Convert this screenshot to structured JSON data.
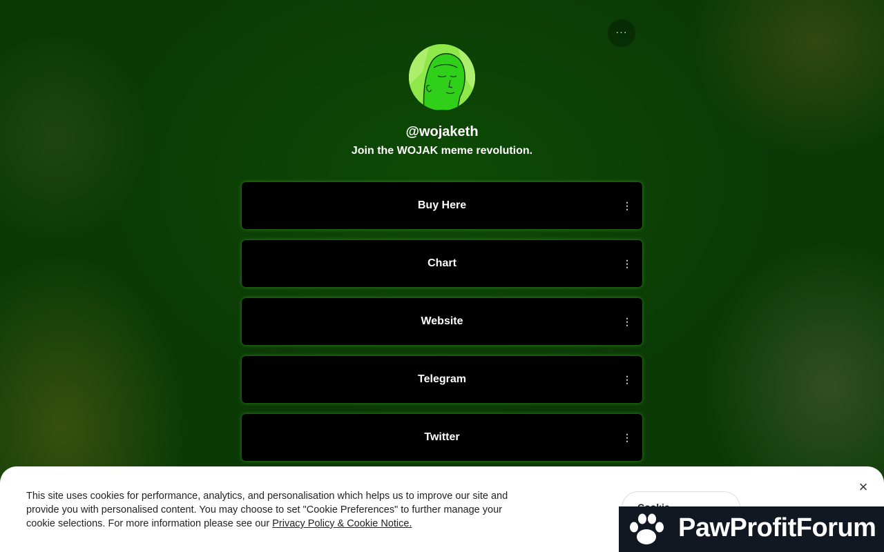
{
  "profile": {
    "handle": "@wojaketh",
    "bio": "Join the WOJAK meme revolution."
  },
  "header": {
    "more_label": "···"
  },
  "links": [
    {
      "label": "Buy Here",
      "menu": "⋮"
    },
    {
      "label": "Chart",
      "menu": "⋮"
    },
    {
      "label": "Website",
      "menu": "⋮"
    },
    {
      "label": "Telegram",
      "menu": "⋮"
    },
    {
      "label": "Twitter",
      "menu": "⋮"
    }
  ],
  "cookie_banner": {
    "text": "This site uses cookies for performance, analytics, and personalisation which helps us to improve our site and provide you with personalised content. You may choose to set \"Cookie Preferences\" to further manage your cookie selections. For more information please see our ",
    "link_text": "Privacy Policy & Cookie Notice.",
    "preferences_label": "Cookie Preferences",
    "close_label": "×"
  },
  "watermark": {
    "text": "PawProfitForum"
  },
  "colors": {
    "background": "#0b3a06",
    "button": "#000000",
    "avatar_green": "#7be03a"
  }
}
